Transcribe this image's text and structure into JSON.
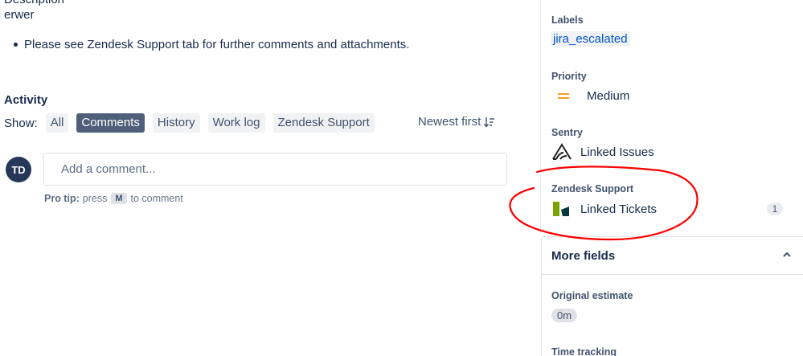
{
  "description": {
    "cut_text": "Description",
    "line": "erwer",
    "bullet": "Please see Zendesk Support tab for further comments and attachments."
  },
  "activity": {
    "title": "Activity",
    "show_label": "Show:",
    "filters": [
      {
        "label": "All",
        "active": false
      },
      {
        "label": "Comments",
        "active": true
      },
      {
        "label": "History",
        "active": false
      },
      {
        "label": "Work log",
        "active": false
      },
      {
        "label": "Zendesk Support",
        "active": false
      }
    ],
    "sort_label": "Newest first",
    "avatar_initials": "TD",
    "comment_placeholder": "Add a comment...",
    "pro_tip": {
      "label": "Pro tip:",
      "pre": "press",
      "key": "M",
      "post": "to comment"
    }
  },
  "sidebar": {
    "labels": {
      "label": "Labels",
      "tag": "jira_escalated"
    },
    "priority": {
      "label": "Priority",
      "value": "Medium",
      "icon": "priority-medium-icon"
    },
    "sentry": {
      "label": "Sentry",
      "value": "Linked Issues",
      "icon": "sentry-icon"
    },
    "zendesk": {
      "label": "Zendesk Support",
      "value": "Linked Tickets",
      "count": "1",
      "icon": "zendesk-icon"
    },
    "more_fields": {
      "label": "More fields"
    },
    "original_estimate": {
      "label": "Original estimate",
      "value": "0m"
    },
    "time_tracking": {
      "label": "Time tracking"
    }
  },
  "colors": {
    "text": "#172b4d",
    "link": "#0052cc",
    "active_filter": "#505f79",
    "priority_medium": "#ff991f",
    "annotation": "#ff0000"
  }
}
